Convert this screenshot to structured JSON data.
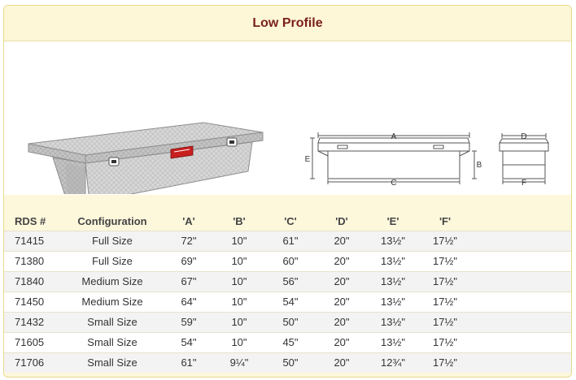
{
  "header": {
    "title": "Low Profile"
  },
  "diagram": {
    "front_labels": {
      "a": "A",
      "b": "B",
      "c": "C",
      "e": "E"
    },
    "side_labels": {
      "d": "D",
      "f": "F"
    }
  },
  "table": {
    "columns": [
      "RDS #",
      "Configuration",
      "'A'",
      "'B'",
      "'C'",
      "'D'",
      "'E'",
      "'F'"
    ],
    "rows": [
      [
        "71415",
        "Full Size",
        "72\"",
        "10\"",
        "61\"",
        "20\"",
        "13½\"",
        "17½\""
      ],
      [
        "71380",
        "Full Size",
        "69\"",
        "10\"",
        "60\"",
        "20\"",
        "13½\"",
        "17½\""
      ],
      [
        "71840",
        "Medium Size",
        "67\"",
        "10\"",
        "56\"",
        "20\"",
        "13½\"",
        "17½\""
      ],
      [
        "71450",
        "Medium Size",
        "64\"",
        "10\"",
        "54\"",
        "20\"",
        "13½\"",
        "17½\""
      ],
      [
        "71432",
        "Small Size",
        "59\"",
        "10\"",
        "50\"",
        "20\"",
        "13½\"",
        "17½\""
      ],
      [
        "71605",
        "Small Size",
        "54\"",
        "10\"",
        "45\"",
        "20\"",
        "13½\"",
        "17½\""
      ],
      [
        "71706",
        "Small Size",
        "61\"",
        "9¼\"",
        "50\"",
        "20\"",
        "12¾\"",
        "17½\""
      ]
    ]
  }
}
